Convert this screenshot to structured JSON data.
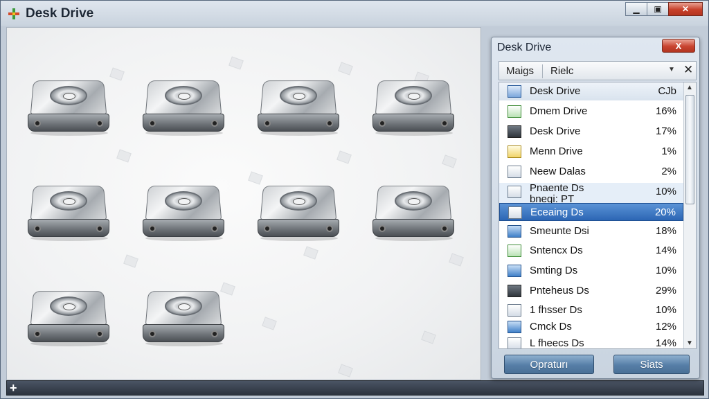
{
  "window": {
    "title": "Desk Drive",
    "controls": [
      "minimize",
      "maximize",
      "close"
    ]
  },
  "canvas": {
    "drives": [
      {
        "icon": "hard-drive-icon"
      },
      {
        "icon": "hard-drive-icon"
      },
      {
        "icon": "hard-drive-icon"
      },
      {
        "icon": "hard-drive-icon"
      },
      {
        "icon": "hard-drive-icon"
      },
      {
        "icon": "hard-drive-icon"
      },
      {
        "icon": "hard-drive-icon"
      },
      {
        "icon": "hard-drive-icon"
      },
      {
        "icon": "hard-drive-icon"
      },
      {
        "icon": "hard-drive-icon"
      }
    ]
  },
  "statusbar": {
    "add_label": "+"
  },
  "panel": {
    "title": "Desk Drive",
    "close_label": "X",
    "filter": {
      "left": "Maigs",
      "right": "Rielc",
      "clear": "✕"
    },
    "header": {
      "name": "Desk Drive",
      "value": "CJb"
    },
    "rows": [
      {
        "name": "Dmem Drive",
        "value": "16%",
        "icon": "green"
      },
      {
        "name": "Desk Drive",
        "value": "17%",
        "icon": "dark"
      },
      {
        "name": "Menn Drive",
        "value": "1%",
        "icon": "yellow"
      },
      {
        "name": "Neew Dalas",
        "value": "2%",
        "icon": "doc"
      },
      {
        "name": "Pnaente Ds\nbnegi: PT",
        "value": "10%",
        "icon": "doc",
        "highlight": true
      },
      {
        "name": "Eceaing Ds",
        "value": "20%",
        "icon": "doc",
        "selected": true
      },
      {
        "name": "Smeunte Dsi",
        "value": "18%",
        "icon": "blue"
      },
      {
        "name": "Sntencx Ds",
        "value": "14%",
        "icon": "green"
      },
      {
        "name": "Smting Ds",
        "value": "10%",
        "icon": "blue"
      },
      {
        "name": "Pnteheus Ds",
        "value": "29%",
        "icon": "dark"
      },
      {
        "name": "1 fhsser Ds",
        "value": "10%",
        "icon": "doc"
      },
      {
        "name": "Cmck Ds",
        "value": "12%",
        "icon": "chart"
      },
      {
        "name": "L fheecs Ds",
        "value": "14%",
        "icon": "doc"
      }
    ],
    "buttons": {
      "primary": "Opraturı",
      "secondary": "Siats"
    }
  }
}
